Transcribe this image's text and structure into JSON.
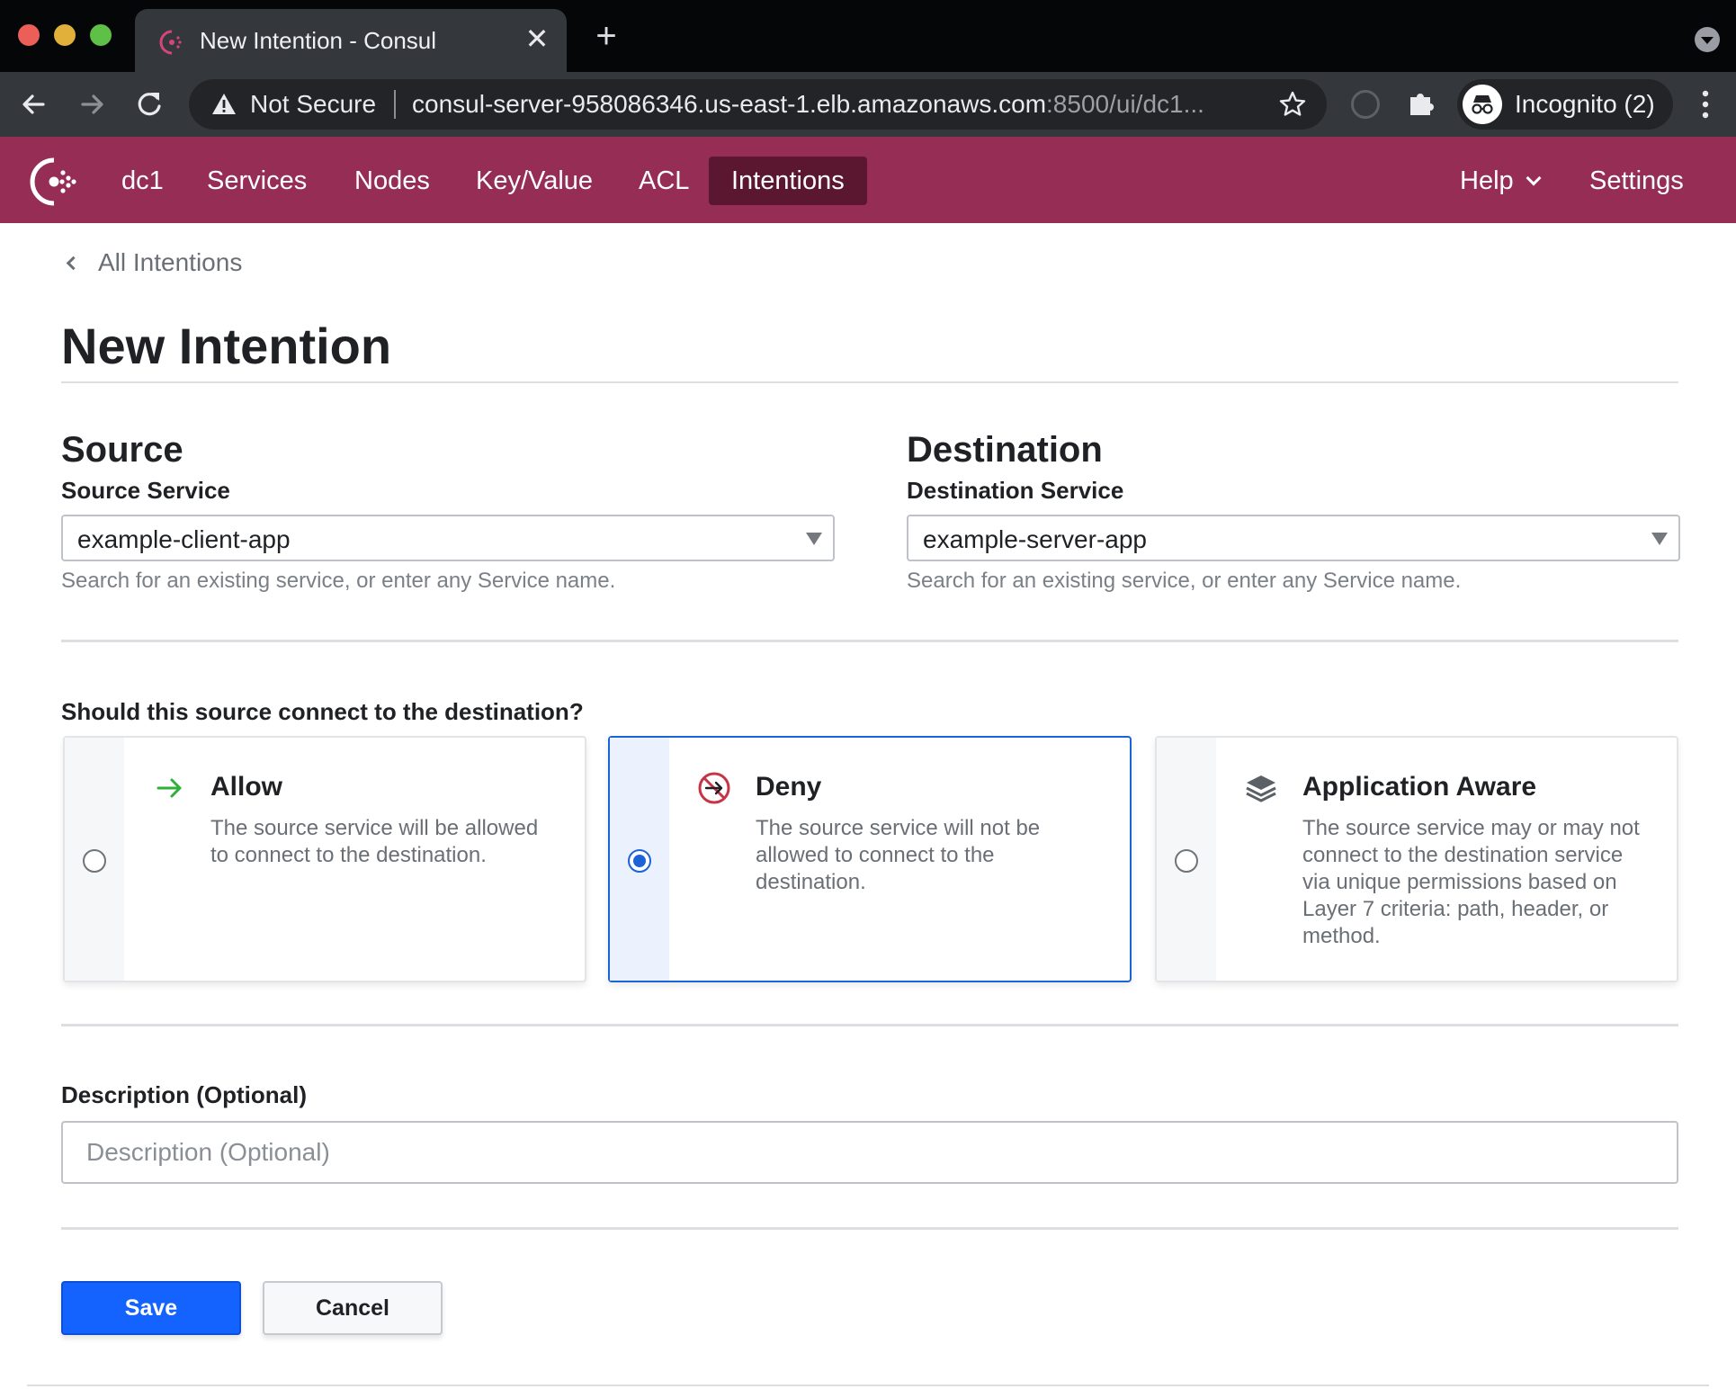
{
  "browser": {
    "tab_title": "New Intention - Consul",
    "tab_close": "✕",
    "new_tab": "+",
    "security_label": "Not Secure",
    "url_main": "consul-server-958086346.us-east-1.elb.amazonaws.com",
    "url_rest": ":8500/ui/dc1...",
    "profile_label": "Incognito (2)",
    "icons": [
      "back-arrow-icon",
      "forward-arrow-icon",
      "reload-icon",
      "warning-icon",
      "star-icon",
      "puzzle-icon",
      "incognito-icon",
      "kebab-menu-icon"
    ]
  },
  "nav": {
    "datacenter": "dc1",
    "items": [
      {
        "label": "Services"
      },
      {
        "label": "Nodes"
      },
      {
        "label": "Key/Value"
      },
      {
        "label": "ACL"
      },
      {
        "label": "Intentions",
        "active": true
      }
    ],
    "help": "Help",
    "settings": "Settings",
    "brand_color": "#962d55",
    "active_color": "#5b1730"
  },
  "page": {
    "breadcrumb": "All Intentions",
    "title": "New Intention"
  },
  "source": {
    "heading": "Source",
    "label": "Source Service",
    "value": "example-client-app",
    "help": "Search for an existing service, or enter any Service name."
  },
  "destination": {
    "heading": "Destination",
    "label": "Destination Service",
    "value": "example-server-app",
    "help": "Search for an existing service, or enter any Service name."
  },
  "action": {
    "question": "Should this source connect to the destination?",
    "options": [
      {
        "title": "Allow",
        "description": "The source service will be allowed to connect to the destination.",
        "icon": "arrow-right-icon",
        "selected": false
      },
      {
        "title": "Deny",
        "description": "The source service will not be allowed to connect to the destination.",
        "icon": "deny-icon",
        "selected": true
      },
      {
        "title": "Application Aware",
        "description": "The source service may or may not connect to the destination service via unique permissions based on Layer 7 criteria: path, header, or method.",
        "icon": "layers-icon",
        "selected": false
      }
    ]
  },
  "description": {
    "label": "Description (Optional)",
    "placeholder": "Description (Optional)",
    "value": ""
  },
  "buttons": {
    "save": "Save",
    "cancel": "Cancel"
  },
  "colors": {
    "primary": "#1563ff",
    "selected_border": "#1d63d8",
    "allow_green": "#2eb039",
    "deny_red": "#c73445"
  }
}
